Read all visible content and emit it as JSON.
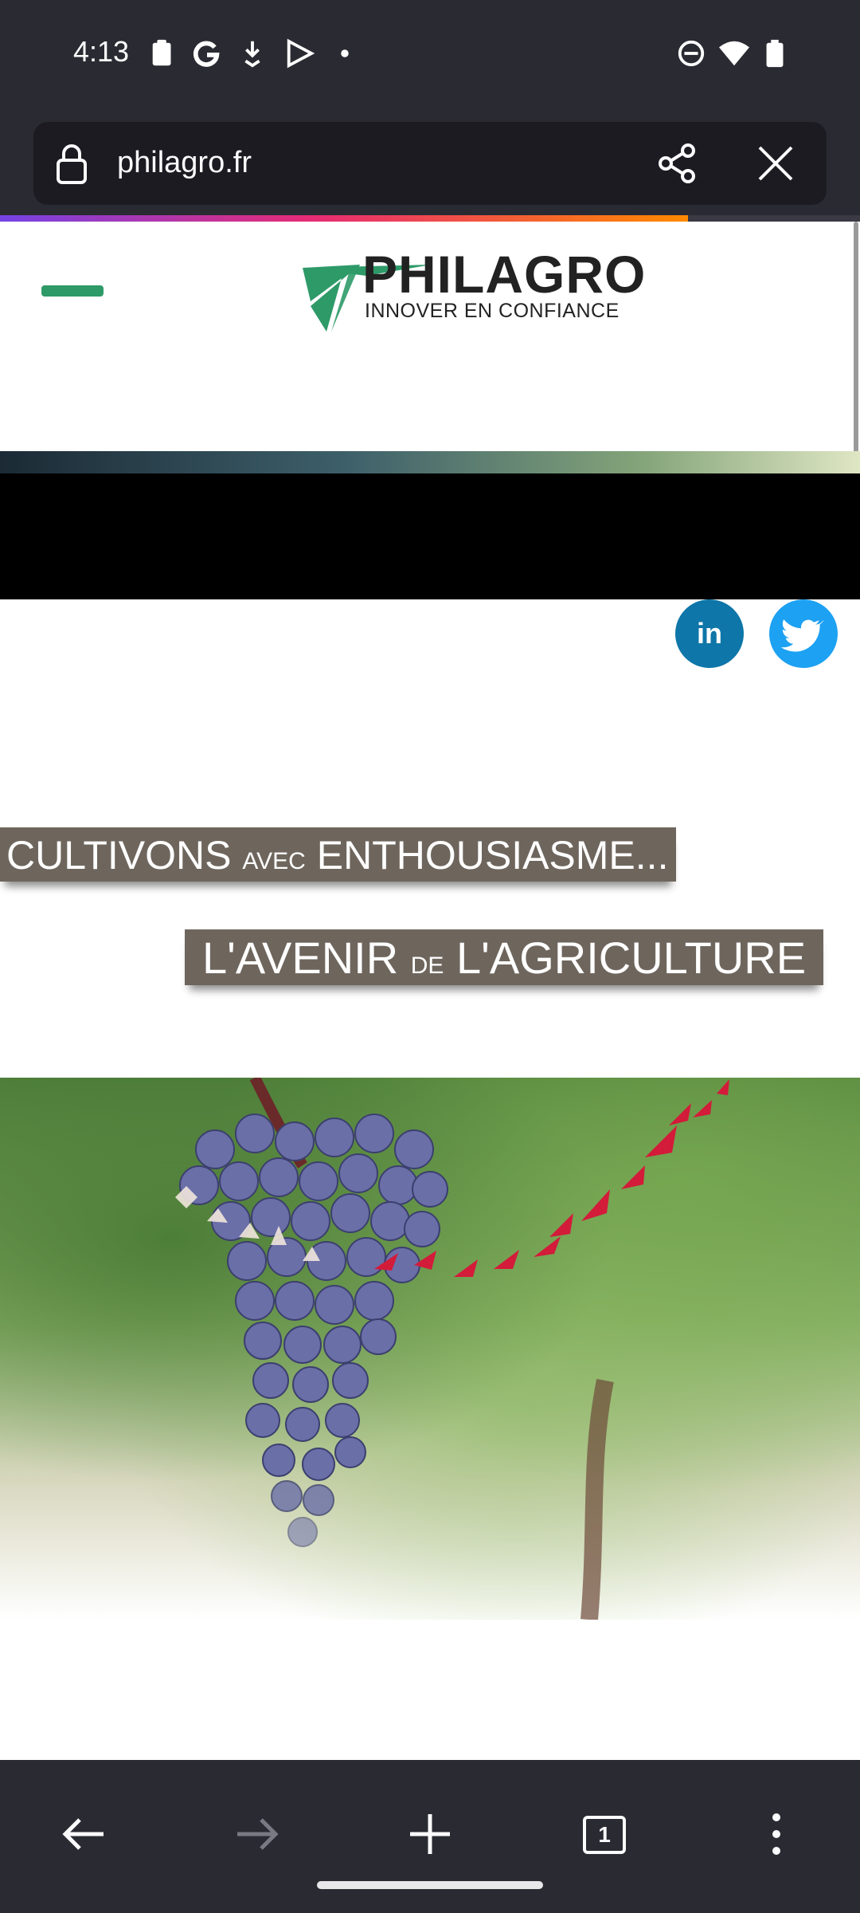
{
  "status_bar": {
    "time": "4:13",
    "left_icons": [
      "clipboard-icon",
      "google-g-icon",
      "download-alert-icon",
      "play-store-icon",
      "dot-icon"
    ],
    "right_icons": [
      "do-not-disturb-icon",
      "wifi-icon",
      "battery-charging-icon"
    ]
  },
  "browser": {
    "url": "philagro.fr",
    "lock_icon": "lock-icon",
    "share_icon": "share-icon",
    "close_icon": "close-icon",
    "progress_percent": 80,
    "tab_count": "1"
  },
  "site": {
    "brand_name": "PHILAGRO",
    "tagline": "INNOVER EN CONFIANCE",
    "social": {
      "linkedin_label": "in",
      "twitter_icon": "twitter-bird-icon"
    },
    "banner1": {
      "word1": "CULTIVONS",
      "small": "AVEC",
      "word2": "ENTHOUSIASME..."
    },
    "banner2": {
      "word1": "L'AVENIR",
      "small": "DE",
      "word2": "L'AGRICULTURE"
    }
  },
  "colors": {
    "status_bg": "#2a2a32",
    "brand_green": "#2e9a68",
    "linkedin": "#0e76a8",
    "twitter": "#1da1f2",
    "banner_bg": "#6e665d"
  }
}
